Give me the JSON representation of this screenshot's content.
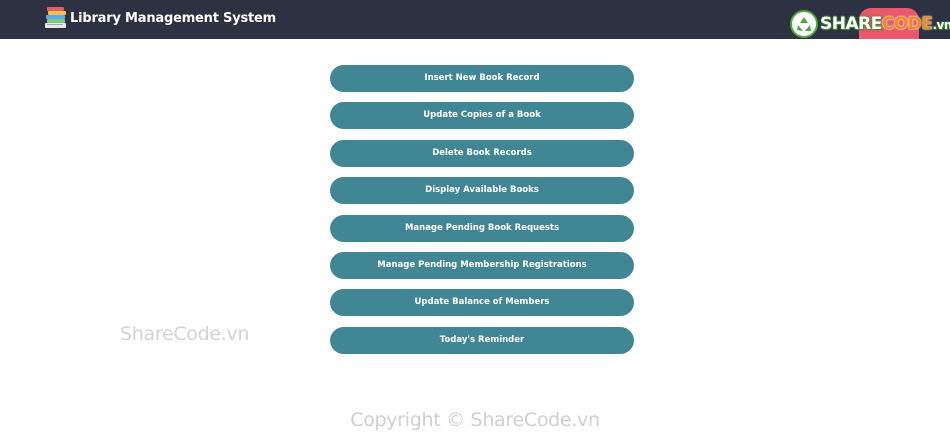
{
  "header": {
    "title": "Library Management System",
    "logo_icon": "books-stack-icon",
    "user_button_color": "#e8576b"
  },
  "watermark_logo": {
    "prefix": "SHARE",
    "suffix": "CODE",
    "tld": ".vn"
  },
  "menu": {
    "items": [
      {
        "label": "Insert New Book Record"
      },
      {
        "label": "Update Copies of a Book"
      },
      {
        "label": "Delete Book Records"
      },
      {
        "label": "Display Available Books"
      },
      {
        "label": "Manage Pending Book Requests"
      },
      {
        "label": "Manage Pending Membership Registrations"
      },
      {
        "label": "Update Balance of Members"
      },
      {
        "label": "Today's Reminder"
      }
    ],
    "button_color": "#418694"
  },
  "side_watermark": "ShareCode.vn",
  "footer_watermark": "Copyright © ShareCode.vn"
}
